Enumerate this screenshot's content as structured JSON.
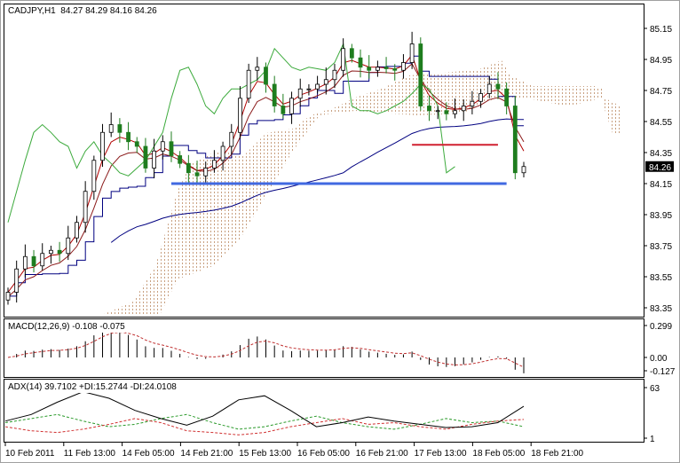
{
  "header": {
    "symbol": "CADJPY,H1",
    "ohlc": "84.27 84.29 84.16 84.26"
  },
  "macd": {
    "label": "MACD(12,26,9) -0.108 -0.075",
    "scale": [
      "0.299",
      "0.00",
      "-0.127"
    ]
  },
  "adx": {
    "label": "ADX(14) 39.7102 +DI:15.2744 -DI:24.0108",
    "scale": [
      "63",
      "1"
    ]
  },
  "colors": {
    "bull": "#ffffff",
    "bear": "#1e7d1e",
    "kijun": "#000080",
    "tenkan": "#b00000",
    "chikou": "#3caa3c",
    "cloud": "#c8a080",
    "support": "#4169e1",
    "resistance": "#d02030"
  },
  "chart_data": {
    "type": "candlestick",
    "title": "CADJPY,H1",
    "current_price": "84.26",
    "price_ticks": [
      "85.15",
      "84.95",
      "84.75",
      "84.55",
      "84.35",
      "84.15",
      "83.95",
      "83.75",
      "83.55",
      "83.35"
    ],
    "ylim": [
      83.35,
      85.15
    ],
    "time_ticks": [
      "10 Feb 2011",
      "11 Feb 13:00",
      "14 Feb 05:00",
      "14 Feb 21:00",
      "15 Feb 13:00",
      "16 Feb 05:00",
      "16 Feb 21:00",
      "17 Feb 13:00",
      "18 Feb 05:00",
      "18 Feb 21:00"
    ],
    "close": [
      83.45,
      83.6,
      83.68,
      83.62,
      83.7,
      83.72,
      83.7,
      83.8,
      83.9,
      84.1,
      84.3,
      84.48,
      84.53,
      84.48,
      84.42,
      84.39,
      84.25,
      84.36,
      84.42,
      84.33,
      84.28,
      84.22,
      84.2,
      84.25,
      84.3,
      84.39,
      84.48,
      84.7,
      84.88,
      84.9,
      84.79,
      84.65,
      84.6,
      84.7,
      84.76,
      84.76,
      84.79,
      84.82,
      84.88,
      85.02,
      84.96,
      84.9,
      84.88,
      84.9,
      84.89,
      84.88,
      84.93,
      85.05,
      84.65,
      84.62,
      84.62,
      84.6,
      84.62,
      84.65,
      84.68,
      84.73,
      84.79,
      84.76,
      84.65,
      84.22,
      84.26
    ],
    "levels": [
      {
        "name": "support",
        "price": 84.15,
        "from_index": 19,
        "to_index": 58
      },
      {
        "name": "resistance",
        "price": 84.4,
        "from_index": 47,
        "to_index": 57
      }
    ],
    "adx_series": {
      "adx": [
        22,
        30,
        45,
        58,
        50,
        35,
        25,
        17,
        28,
        48,
        53,
        35,
        15,
        20,
        27,
        22,
        18,
        14,
        15,
        20,
        40
      ],
      "plus_di": [
        20,
        25,
        30,
        22,
        15,
        18,
        25,
        30,
        20,
        12,
        15,
        22,
        28,
        20,
        15,
        12,
        18,
        25,
        20,
        22,
        15
      ],
      "minus_di": [
        15,
        10,
        8,
        12,
        18,
        25,
        20,
        10,
        8,
        5,
        8,
        15,
        20,
        25,
        18,
        20,
        15,
        12,
        18,
        22,
        24
      ]
    }
  }
}
